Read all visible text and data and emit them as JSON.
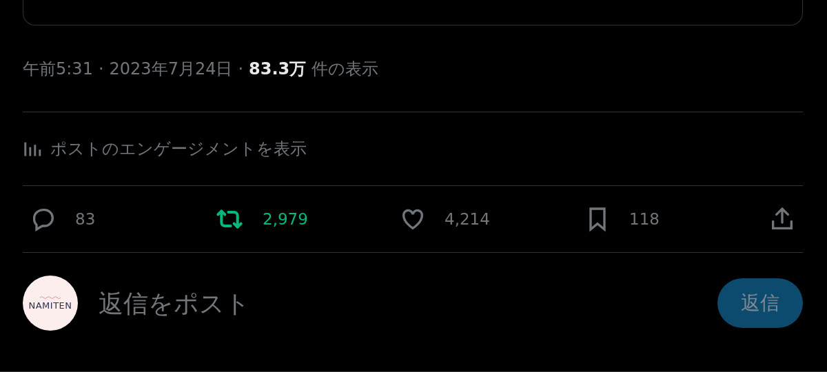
{
  "post_meta": {
    "time": "午前5:31",
    "separator_1": "·",
    "date": "2023年7月24日",
    "separator_2": "·",
    "views_count": "83.3万",
    "views_label": "件の表示"
  },
  "engagement_link": {
    "label": "ポストのエンゲージメントを表示"
  },
  "actions": [
    {
      "kind": "reply",
      "count": "83",
      "active": false
    },
    {
      "kind": "repost",
      "count": "2,979",
      "active": true
    },
    {
      "kind": "like",
      "count": "4,214",
      "active": false
    },
    {
      "kind": "bookmark",
      "count": "118",
      "active": false
    },
    {
      "kind": "share",
      "active": false
    }
  ],
  "reply_composer": {
    "avatar_text": "NAMITEN",
    "placeholder": "返信をポスト",
    "button": "返信"
  }
}
